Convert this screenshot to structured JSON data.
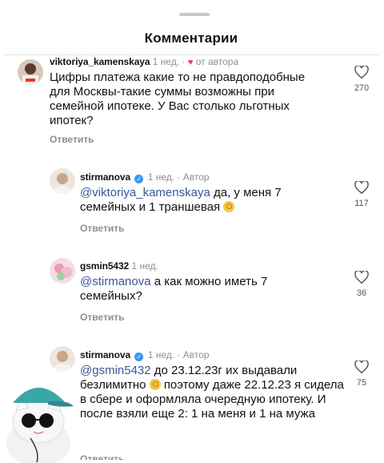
{
  "header": {
    "title": "Комментарии"
  },
  "comments": [
    {
      "username": "viktoriya_kamenskaya",
      "time": "1 нед.",
      "tag": "от автора",
      "text": "Цифры платежа какие то не правдоподобные для Москвы-такие суммы возможны при семейной ипотеке. У Вас столько льготных ипотек?",
      "reply_label": "Ответить",
      "likes": "270"
    },
    {
      "username": "stirmanova",
      "time": "1 нед.",
      "tag": "Автор",
      "mention": "@viktoriya_kamenskaya",
      "text": "да, у меня 7 семейных и 1 траншевая",
      "reply_label": "Ответить",
      "likes": "117"
    },
    {
      "username": "gsmin5432",
      "time": "1 нед.",
      "mention": "@stirmanova",
      "text": "а как можно иметь 7 семейных?",
      "reply_label": "Ответить",
      "likes": "36"
    },
    {
      "username": "stirmanova",
      "time": "1 нед.",
      "tag": "Автор",
      "mention": "@gsmin5432",
      "text_a": "до 23.12.23г их выдавали безлимитно",
      "text_b": "поэтому даже 22.12.23 я сидела в сбере и оформляла очередную ипотеку. И после взяли еще 2: 1 на меня и 1 на мужа",
      "reply_label": "Ответить",
      "likes": "75"
    }
  ],
  "icons": {
    "like": "heart-outline-icon",
    "verified": "verified-badge-icon"
  },
  "colors": {
    "mention": "#385898",
    "verified": "#3897f0",
    "secondary_text": "#8e8e8e",
    "heart": "#ff3040"
  }
}
